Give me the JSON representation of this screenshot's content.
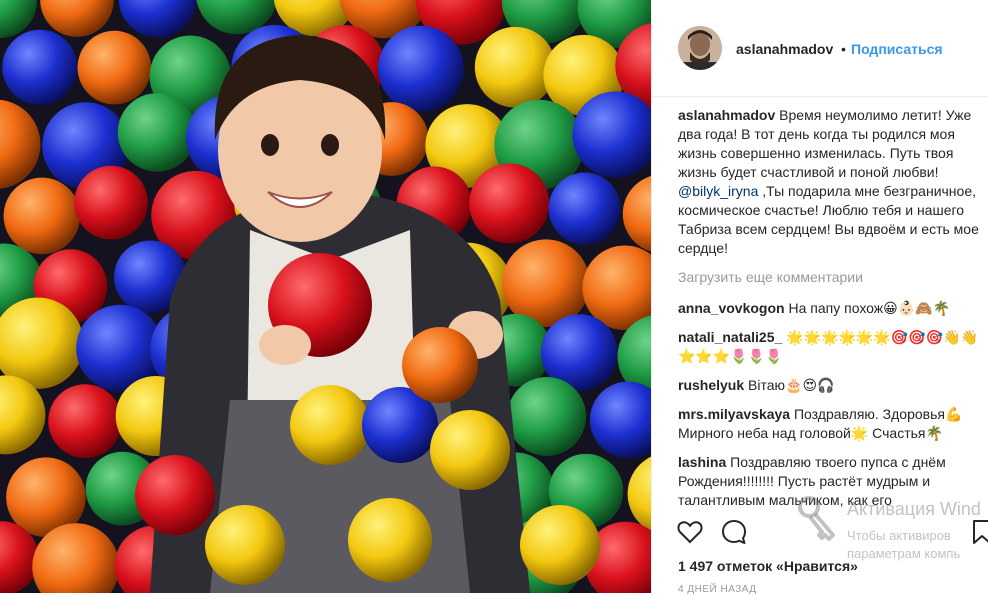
{
  "post": {
    "author": "aslanahmadov",
    "separator": "•",
    "follow_label": "Подписаться",
    "caption_before_mention": "Время неумолимо летит! Уже два года! В тот день когда ты родился моя жизнь совершенно изменилась. Путь твоя жизнь будет счастливой и поной любви!",
    "caption_mention": "@bilyk_iryna",
    "caption_after_mention": " ,Ты подарила мне безграничное, космическое счастье! Люблю тебя и нашего Табриза всем сердцем! Вы вдвоём и есть мое сердце!",
    "load_more": "Загрузить еще комментарии",
    "likes": "1 497 отметок «Нравится»",
    "date": "4 ДНЕЙ НАЗАД"
  },
  "comments": [
    {
      "user": "anna_vovkogon",
      "text": "На папу похож😀👶🏻🙈🌴"
    },
    {
      "user": "natali_natali25_",
      "text": "🌟🌟🌟🌟🌟🌟🎯🎯🎯👋👋⭐⭐⭐🌷🌷🌷"
    },
    {
      "user": "rushelyuk",
      "text": "Вітаю🎂😍🎧"
    },
    {
      "user": "mrs.milyavskaya",
      "text": "Поздравляю. Здоровья💪 Мирного неба над головой🌟 Счастья🌴"
    },
    {
      "user": "lashina",
      "text": "Поздравляю твоего пупса с днём Рождения!!!!!!!! Пусть растёт мудрым и талантливым мальчиком, как его"
    }
  ],
  "icons": {
    "like": "heart-icon",
    "comment": "comment-bubble-icon",
    "save": "bookmark-icon"
  },
  "watermark": {
    "title": "Активация Wind",
    "line1": "Чтобы активиров",
    "line2": "параметрам компь"
  },
  "colors": {
    "link": "#3897f0",
    "mention": "#003569",
    "text": "#262626",
    "muted": "#999999"
  }
}
